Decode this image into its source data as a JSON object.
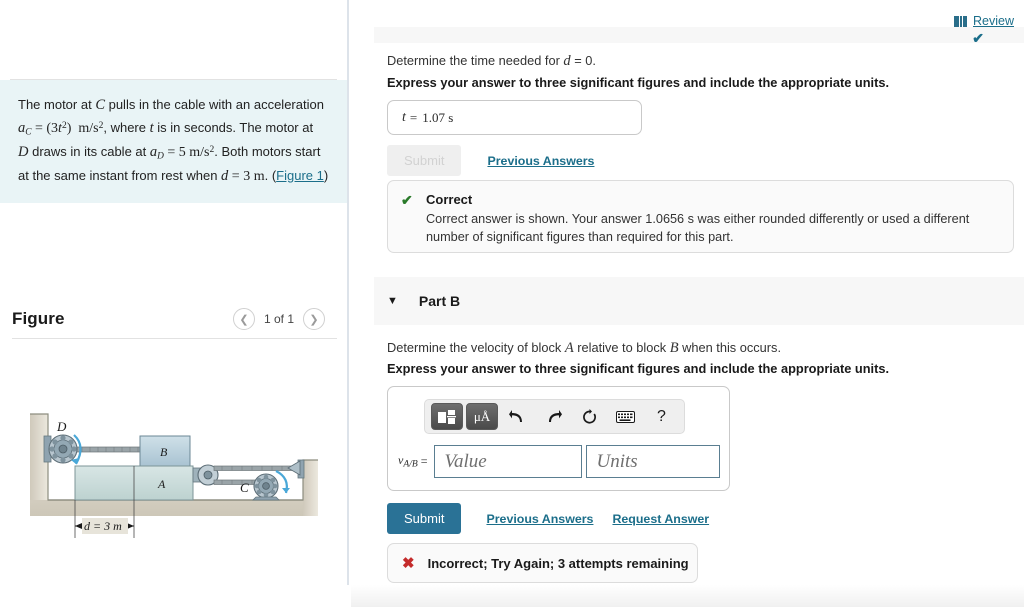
{
  "left": {
    "problem": {
      "line1_a": "The motor at ",
      "var_C": "C",
      "line1_b": " pulls in the cable with an acceleration",
      "eq_aC_var": "a",
      "eq_aC_sub": "C",
      "eq_aC_rest": " = (3t²)  m/s²",
      "line2_b": ", where ",
      "var_t": "t",
      "line2_c": " is in seconds. The motor at",
      "var_D": "D",
      "line3_b": " draws in its cable at ",
      "eq_aD_var": "a",
      "eq_aD_sub": "D",
      "eq_aD_rest": " = 5 m/s²",
      "line3_c": ". Both motors start",
      "line4_a": "at the same instant from rest when ",
      "var_d": "d",
      "eq_d_rest": " = 3 m",
      "line4_b": ". (",
      "figure_link": "Figure 1",
      "line4_c": ")"
    },
    "figure": {
      "title": "Figure",
      "prev_icon": "chevron-left-icon",
      "count": "1 of 1",
      "next_icon": "chevron-right-icon",
      "labels": {
        "motor_d": "D",
        "motor_c": "C",
        "block_a": "A",
        "block_b": "B",
        "dimension": "d = 3 m"
      }
    }
  },
  "right": {
    "review": {
      "icon": "book-icon",
      "label": "Review"
    },
    "part_a": {
      "status_icon": "check-icon",
      "prompt_a": "Determine the time needed for ",
      "prompt_var": "d",
      "prompt_b": " = 0.",
      "instruction": "Express your answer to three significant figures and include the appropriate units.",
      "answer_var": "t",
      "answer_eq": "=",
      "answer_value": "1.07 s",
      "submit_label": "Submit",
      "previous_answers_label": "Previous Answers",
      "feedback": {
        "icon": "check-icon",
        "title": "Correct",
        "body": "Correct answer is shown. Your answer 1.0656 s was either rounded differently or used a different number of significant figures than required for this part."
      }
    },
    "part_b": {
      "caret_icon": "caret-down-icon",
      "label": "Part B",
      "prompt_a": "Determine the velocity of block ",
      "prompt_var_a": "A",
      "prompt_b": " relative to block ",
      "prompt_var_b": "B",
      "prompt_c": " when this occurs.",
      "instruction": "Express your answer to three significant figures and include the appropriate units.",
      "toolbar": [
        {
          "name": "template-icon",
          "glyph": ""
        },
        {
          "name": "units-icon",
          "glyph": "μÅ"
        },
        {
          "name": "undo-icon",
          "glyph": "⬑"
        },
        {
          "name": "redo-icon",
          "glyph": "⬐"
        },
        {
          "name": "reset-icon",
          "glyph": "↻"
        },
        {
          "name": "keyboard-icon",
          "glyph": "⌨"
        },
        {
          "name": "help-icon",
          "glyph": "?"
        }
      ],
      "answer_var": "v",
      "answer_sub": "A/B",
      "answer_eq": "=",
      "value_placeholder": "Value",
      "units_placeholder": "Units",
      "submit_label": "Submit",
      "previous_answers_label": "Previous Answers",
      "request_answer_label": "Request Answer",
      "feedback": {
        "icon": "cross-icon",
        "text": "Incorrect; Try Again; 3 attempts remaining"
      }
    }
  },
  "colors": {
    "link": "#1b6e8a",
    "submit": "#2a7296",
    "correct": "#2a7a2a",
    "incorrect": "#c42b2b",
    "problem_bg": "#e9f4f6",
    "band_bg": "#f7f7f7"
  }
}
